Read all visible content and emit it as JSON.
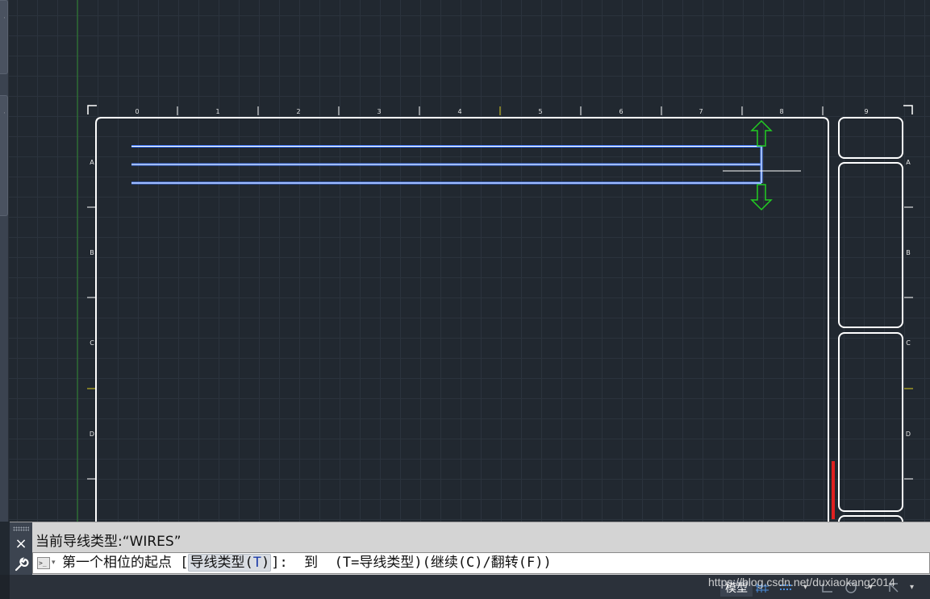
{
  "drawing": {
    "column_ticks": [
      "0",
      "1",
      "2",
      "3",
      "4",
      "5",
      "6",
      "7",
      "8",
      "9"
    ],
    "row_ticks": [
      "A",
      "B",
      "C",
      "D"
    ],
    "wire_color": "#3f78ff",
    "frame_color": "#ffffff",
    "grip_color": "#22cc22"
  },
  "command_line": {
    "history_text": "当前导线类型:“WIRES”",
    "prompt_before": "第一个相位的起点 [",
    "option_label": "导线类型(",
    "option_key": "T",
    "option_close": ")",
    "prompt_after": "]:  到  (T=导线类型)(继续(C)/翻转(F))",
    "close_icon": "×"
  },
  "status_bar": {
    "model_tab": "模型",
    "icons": [
      "grid-icon",
      "snap-icon",
      "dropdown-icon",
      "ortho-icon",
      "polar-icon",
      "osnap-icon",
      "dropdown-icon"
    ]
  },
  "watermark": "https://blog.csdn.net/duxiaokang2014"
}
